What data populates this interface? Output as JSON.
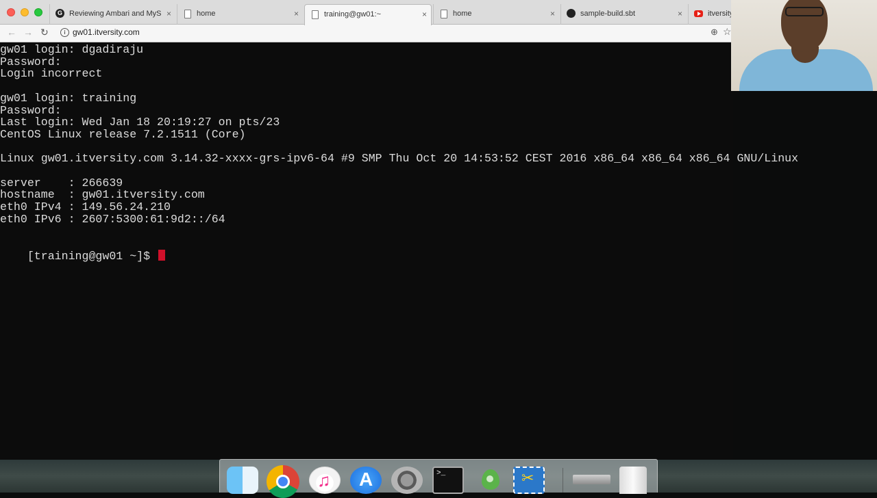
{
  "browser": {
    "tabs": [
      {
        "title": "Reviewing Ambari and MyS",
        "favicon": "g-icon",
        "active": false
      },
      {
        "title": "home",
        "favicon": "document-icon",
        "active": false
      },
      {
        "title": "training@gw01:~",
        "favicon": "document-icon",
        "active": true
      },
      {
        "title": "home",
        "favicon": "document-icon",
        "active": false
      },
      {
        "title": "sample-build.sbt",
        "favicon": "github-icon",
        "active": false
      },
      {
        "title": "itversity",
        "favicon": "youtube-icon",
        "active": false
      }
    ],
    "close_glyph": "×",
    "address": "gw01.itversity.com"
  },
  "terminal": {
    "lines": [
      "gw01 login: dgadiraju",
      "Password:",
      "Login incorrect",
      "",
      "gw01 login: training",
      "Password:",
      "Last login: Wed Jan 18 20:19:27 on pts/23",
      "CentOS Linux release 7.2.1511 (Core)",
      "",
      "Linux gw01.itversity.com 3.14.32-xxxx-grs-ipv6-64 #9 SMP Thu Oct 20 14:53:52 CEST 2016 x86_64 x86_64 x86_64 GNU/Linux",
      "",
      "server    : 266639",
      "hostname  : gw01.itversity.com",
      "eth0 IPv4 : 149.56.24.210",
      "eth0 IPv6 : 2607:5300:61:9d2::/64",
      ""
    ],
    "prompt": "[training@gw01 ~]$ "
  },
  "dock": {
    "items": [
      "finder-icon",
      "chrome-icon",
      "itunes-icon",
      "app-store-icon",
      "system-preferences-icon",
      "terminal-icon",
      "sourcetree-icon",
      "screenshot-tool-icon",
      "external-device-icon",
      "trash-icon"
    ]
  },
  "colors": {
    "terminal_bg": "#0c0c0c",
    "terminal_fg": "#dcdcdc",
    "cursor": "#d0102a"
  }
}
